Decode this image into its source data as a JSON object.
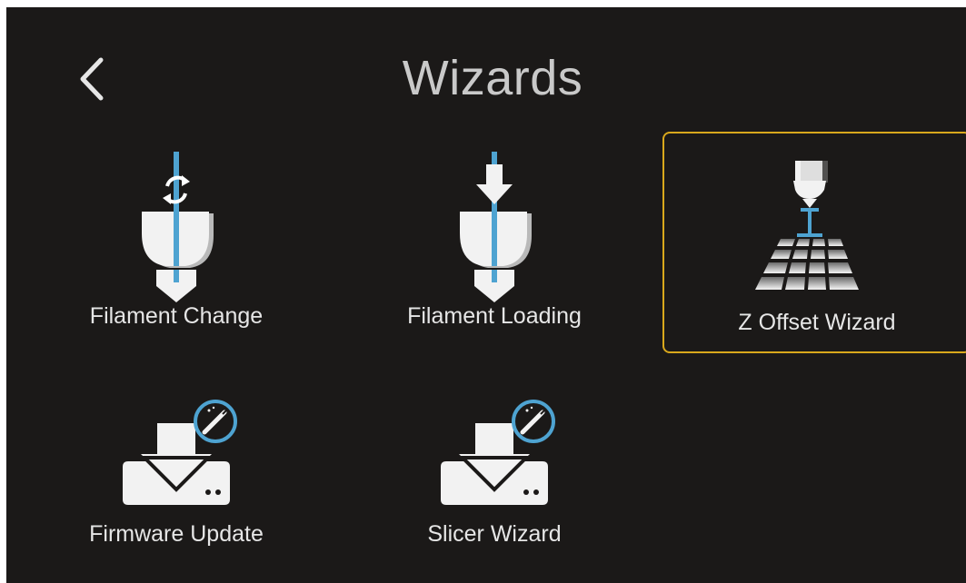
{
  "header": {
    "title": "Wizards",
    "back_icon": "chevron-left-icon"
  },
  "colors": {
    "background": "#1b1918",
    "selected_border": "#d9a81c",
    "accent_blue": "#4ea3d1",
    "text": "#e6e6e6"
  },
  "wizards": [
    {
      "label": "Filament Change",
      "icon": "filament-change-icon",
      "selected": false
    },
    {
      "label": "Filament Loading",
      "icon": "filament-loading-icon",
      "selected": false
    },
    {
      "label": "Z Offset Wizard",
      "icon": "z-offset-icon",
      "selected": true
    },
    {
      "label": "Firmware Update",
      "icon": "firmware-update-icon",
      "selected": false
    },
    {
      "label": "Slicer Wizard",
      "icon": "slicer-wizard-icon",
      "selected": false
    }
  ]
}
